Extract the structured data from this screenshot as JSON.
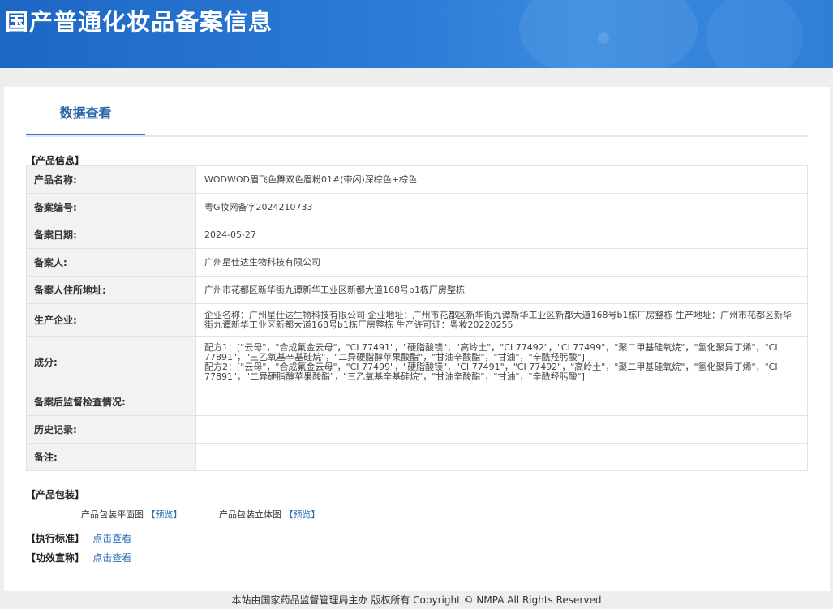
{
  "header": {
    "title": "国产普通化妆品备案信息"
  },
  "tab": {
    "label": "数据查看"
  },
  "sections": {
    "product_info": "【产品信息】",
    "packaging": "【产品包装】",
    "standard": "【执行标准】",
    "efficacy": "【功效宣称】"
  },
  "rows": [
    {
      "label": "产品名称:",
      "value": "WODWOD眉飞色舞双色眉粉01#(带闪)深棕色+棕色"
    },
    {
      "label": "备案编号:",
      "value": "粤G妆网备字2024210733"
    },
    {
      "label": "备案日期:",
      "value": "2024-05-27"
    },
    {
      "label": "备案人:",
      "value": "广州星仕达生物科技有限公司"
    },
    {
      "label": "备案人住所地址:",
      "value": "广州市花都区新华街九谭新华工业区新都大道168号b1栋厂房整栋"
    },
    {
      "label": "生产企业:",
      "value": "企业名称：广州星仕达生物科技有限公司 企业地址：广州市花都区新华街九谭新华工业区新都大道168号b1栋厂房整栋 生产地址：广州市花都区新华街九谭新华工业区新都大道168号b1栋厂房整栋 生产许可证：粤妆20220255"
    },
    {
      "label": "成分:",
      "value_lines": [
        "配方1：[\"云母\"，\"合成氟金云母\"，\"CI 77491\"，\"硬脂酸镁\"，\"高岭土\"，\"CI 77492\"，\"CI 77499\"，\"聚二甲基硅氧烷\"，\"氢化聚异丁烯\"，\"CI 77891\"，\"三乙氧基辛基硅烷\"，\"二异硬脂醇苹果酸酯\"，\"甘油辛酸酯\"，\"甘油\"，\"辛酰羟肟酸\"]",
        "配方2：[\"云母\"，\"合成氟金云母\"，\"CI 77499\"，\"硬脂酸镁\"，\"CI 77491\"，\"CI 77492\"，\"高岭土\"，\"聚二甲基硅氧烷\"，\"氢化聚异丁烯\"，\"CI 77891\"，\"二异硬脂醇苹果酸酯\"，\"三乙氧基辛基硅烷\"，\"甘油辛酸酯\"，\"甘油\"，\"辛酰羟肟酸\"]"
      ]
    },
    {
      "label": "备案后监督检查情况:",
      "value": ""
    },
    {
      "label": "历史记录:",
      "value": ""
    },
    {
      "label": "备注:",
      "value": ""
    }
  ],
  "packaging": {
    "flat_label": "产品包装平面图",
    "flat_link": "【预览】",
    "solid_label": "产品包装立体图",
    "solid_link": "【预览】"
  },
  "standard_link": "点击查看",
  "efficacy_link": "点击查看",
  "footer": "本站由国家药品监督管理局主办 版权所有 Copyright © NMPA All Rights Reserved"
}
